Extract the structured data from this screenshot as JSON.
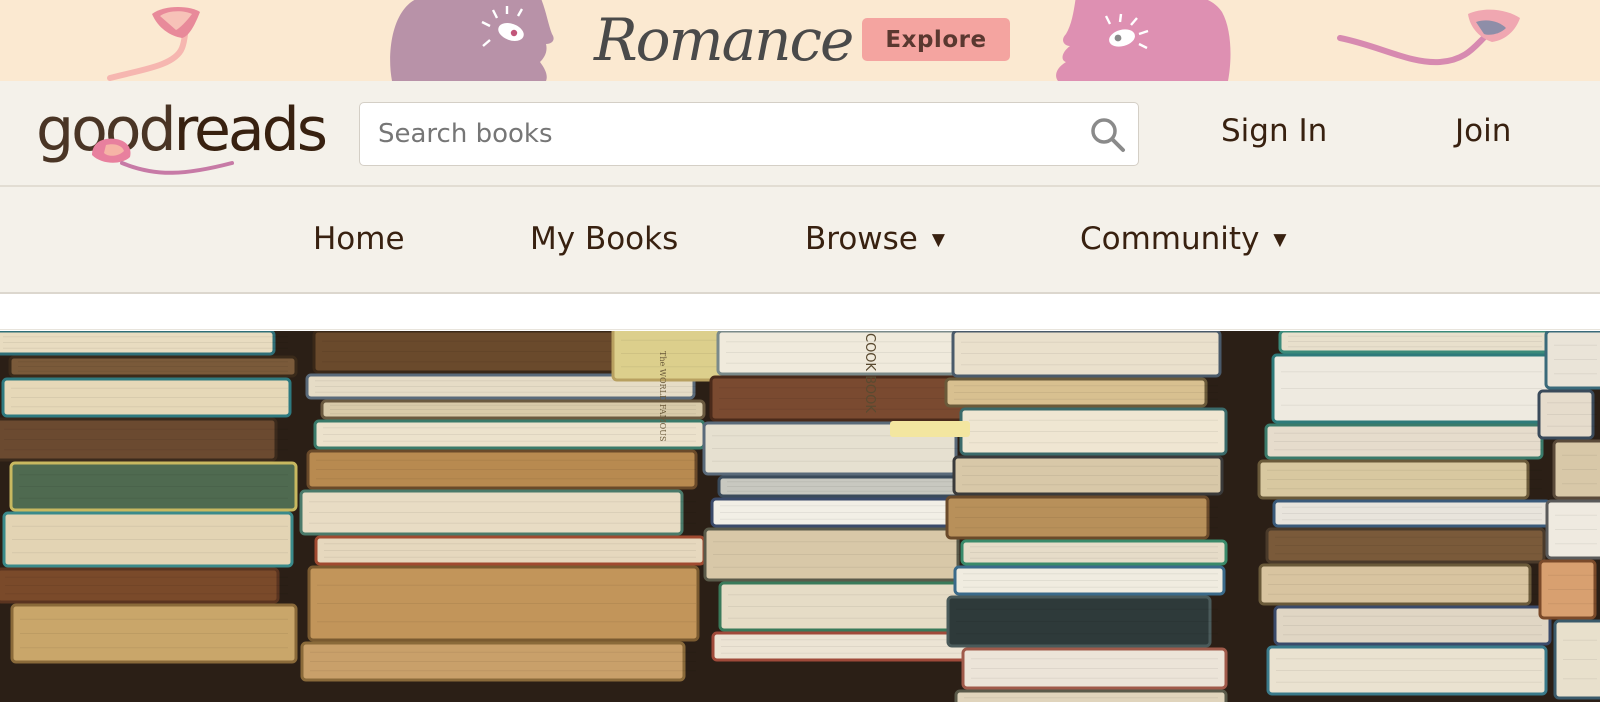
{
  "promo": {
    "title": "Romance",
    "button_label": "Explore",
    "colors": {
      "background": "#fbe9d1",
      "button": "#f4a4a0",
      "face_left": "#b892a8",
      "face_right": "#de90b2"
    }
  },
  "header": {
    "logo_text_part1": "good",
    "logo_text_part2": "reads",
    "search": {
      "placeholder": "Search books",
      "value": ""
    },
    "sign_in_label": "Sign In",
    "join_label": "Join",
    "icons": {
      "search": "search-icon"
    },
    "colors": {
      "background": "#f4f1ea",
      "text": "#382110"
    }
  },
  "nav": {
    "items": [
      {
        "label": "Home",
        "has_dropdown": false
      },
      {
        "label": "My Books",
        "has_dropdown": false
      },
      {
        "label": "Browse",
        "has_dropdown": true,
        "caret": "▼"
      },
      {
        "label": "Community",
        "has_dropdown": true,
        "caret": "▼"
      }
    ]
  },
  "hero": {
    "image_subject": "stacks of old books",
    "visible_spine_text": [
      "COOK BOOK",
      "The WORLD FAMOUS"
    ]
  }
}
